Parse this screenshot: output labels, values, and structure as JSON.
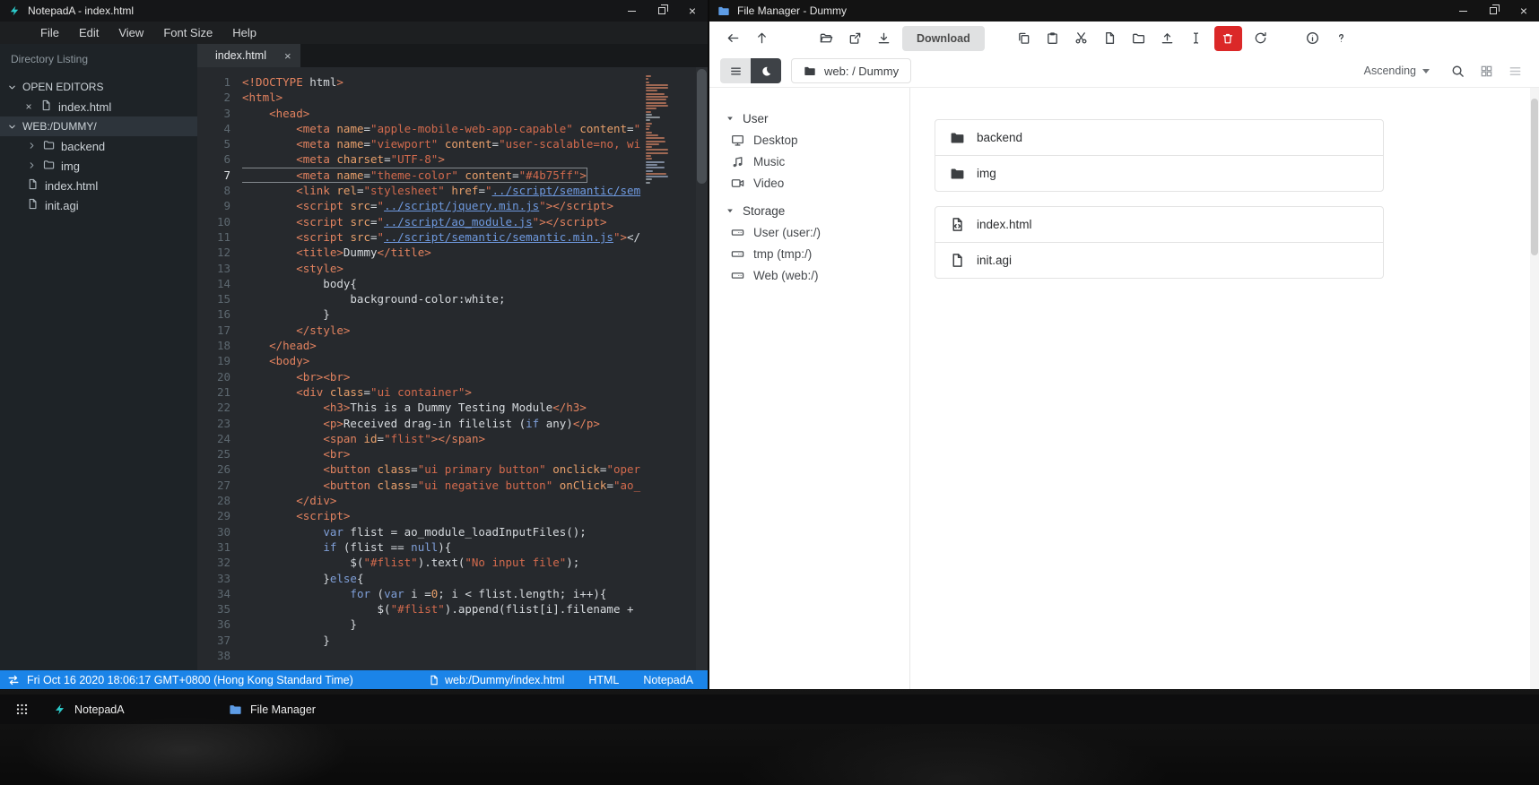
{
  "notepad": {
    "window_title": "NotepadA - index.html",
    "menu": [
      "File",
      "Edit",
      "View",
      "Font Size",
      "Help"
    ],
    "sidebar": {
      "title": "Directory Listing",
      "sections": [
        {
          "label": "OPEN EDITORS",
          "selected": false,
          "items": [
            {
              "name": "index.html",
              "type": "open-file"
            }
          ]
        },
        {
          "label": "WEB:/DUMMY/",
          "selected": true,
          "items": [
            {
              "name": "backend",
              "type": "folder"
            },
            {
              "name": "img",
              "type": "folder"
            },
            {
              "name": "index.html",
              "type": "file"
            },
            {
              "name": "init.agi",
              "type": "file"
            }
          ]
        }
      ]
    },
    "tab": {
      "label": "index.html"
    },
    "active_line": 7,
    "code_lines": [
      "<!DOCTYPE html>",
      "<html>",
      "    <head>",
      "        <meta name=\"apple-mobile-web-app-capable\" content=\"",
      "        <meta name=\"viewport\" content=\"user-scalable=no, wi",
      "        <meta charset=\"UTF-8\">",
      "        <meta name=\"theme-color\" content=\"#4b75ff\">",
      "        <link rel=\"stylesheet\" href=\"../script/semantic/sem",
      "        <script src=\"../script/jquery.min.js\"></script>",
      "        <script src=\"../script/ao_module.js\"></script>",
      "        <script src=\"../script/semantic/semantic.min.js\"></",
      "        <title>Dummy</title>",
      "        <style>",
      "            body{",
      "                background-color:white;",
      "            }",
      "        </style>",
      "    </head>",
      "    <body>",
      "        <br><br>",
      "        <div class=\"ui container\">",
      "            <h3>This is a Dummy Testing Module</h3>",
      "            <p>Received drag-in filelist (if any)</p>",
      "            <span id=\"flist\"></span>",
      "            <br>",
      "            <button class=\"ui primary button\" onclick=\"oper",
      "            <button class=\"ui negative button\" onClick=\"ao_",
      "        </div>",
      "        <script>",
      "            var flist = ao_module_loadInputFiles();",
      "            if (flist == null){",
      "                $(\"#flist\").text(\"No input file\");",
      "            }else{",
      "                for (var i =0; i < flist.length; i++){",
      "                    $(\"#flist\").append(flist[i].filename + ",
      "                }",
      "            }",
      ""
    ],
    "statusbar": {
      "time": "Fri Oct 16 2020 18:06:17 GMT+0800 (Hong Kong Standard Time)",
      "path": "web:/Dummy/index.html",
      "language": "HTML",
      "app": "NotepadA"
    }
  },
  "filemanager": {
    "window_title": "File Manager - Dummy",
    "breadcrumb": "web: / Dummy",
    "toolbar": {
      "buttons": [
        {
          "name": "back",
          "icon": "arrow-left"
        },
        {
          "name": "up",
          "icon": "arrow-up"
        },
        {
          "name": "open",
          "icon": "folder-open",
          "gap": "l"
        },
        {
          "name": "open-in-new",
          "icon": "external"
        },
        {
          "name": "download-file",
          "icon": "download"
        },
        {
          "name": "download",
          "label": "Download"
        },
        {
          "name": "copy",
          "icon": "copy",
          "gap": "s"
        },
        {
          "name": "paste",
          "icon": "paste"
        },
        {
          "name": "cut",
          "icon": "cut"
        },
        {
          "name": "new-file",
          "icon": "file"
        },
        {
          "name": "new-folder",
          "icon": "folder-new"
        },
        {
          "name": "upload",
          "icon": "upload"
        },
        {
          "name": "rename",
          "icon": "ibeam"
        },
        {
          "name": "delete",
          "icon": "trash",
          "danger": true
        },
        {
          "name": "refresh",
          "icon": "refresh"
        },
        {
          "name": "properties",
          "icon": "info",
          "gap": "s"
        },
        {
          "name": "help",
          "icon": "help"
        }
      ],
      "view": {
        "sort_label": "Ascending"
      }
    },
    "sidebar": {
      "sections": [
        {
          "label": "User",
          "items": [
            {
              "label": "Desktop",
              "icon": "monitor"
            },
            {
              "label": "Music",
              "icon": "music"
            },
            {
              "label": "Video",
              "icon": "video"
            }
          ]
        },
        {
          "label": "Storage",
          "items": [
            {
              "label": "User (user:/)",
              "icon": "drive"
            },
            {
              "label": "tmp (tmp:/)",
              "icon": "drive"
            },
            {
              "label": "Web (web:/)",
              "icon": "drive"
            }
          ]
        }
      ]
    },
    "file_groups": [
      [
        {
          "name": "backend",
          "icon": "folder"
        },
        {
          "name": "img",
          "icon": "folder"
        }
      ],
      [
        {
          "name": "index.html",
          "icon": "file-code"
        },
        {
          "name": "init.agi",
          "icon": "file"
        }
      ]
    ]
  },
  "taskbar": {
    "items": [
      {
        "label": "NotepadA",
        "icon": "logo-np",
        "color": "#2cc9c9"
      },
      {
        "label": "File Manager",
        "icon": "folder",
        "color": "#5d9ce6"
      }
    ]
  },
  "colors": {
    "statusbar_blue": "#1b84e8",
    "danger_red": "#db2828",
    "accent_teal": "#2cc9c9",
    "folder_blue": "#5d9ce6"
  }
}
